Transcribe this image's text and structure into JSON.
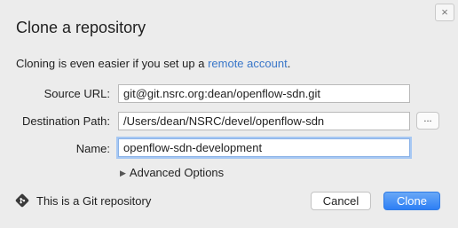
{
  "dialog": {
    "close_glyph": "×",
    "title": "Clone a repository",
    "intro_text": "Cloning is even easier if you set up a ",
    "intro_link": "remote account",
    "intro_end": "."
  },
  "form": {
    "source_url_label": "Source URL:",
    "source_url_value": "git@git.nsrc.org:dean/openflow-sdn.git",
    "destination_path_label": "Destination Path:",
    "destination_path_value": "/Users/dean/NSRC/devel/openflow-sdn",
    "browse_label": "...",
    "name_label": "Name:",
    "name_value": "openflow-sdn-development",
    "advanced_options_label": "Advanced Options"
  },
  "footer": {
    "git_status": "This is a Git repository",
    "git_icon": "git-diamond-icon",
    "cancel_label": "Cancel",
    "clone_label": "Clone"
  },
  "colors": {
    "background": "#ececec",
    "link": "#3a77c9",
    "primary_button": "#2d7ff5",
    "focus_ring": "#a7c8f3"
  }
}
